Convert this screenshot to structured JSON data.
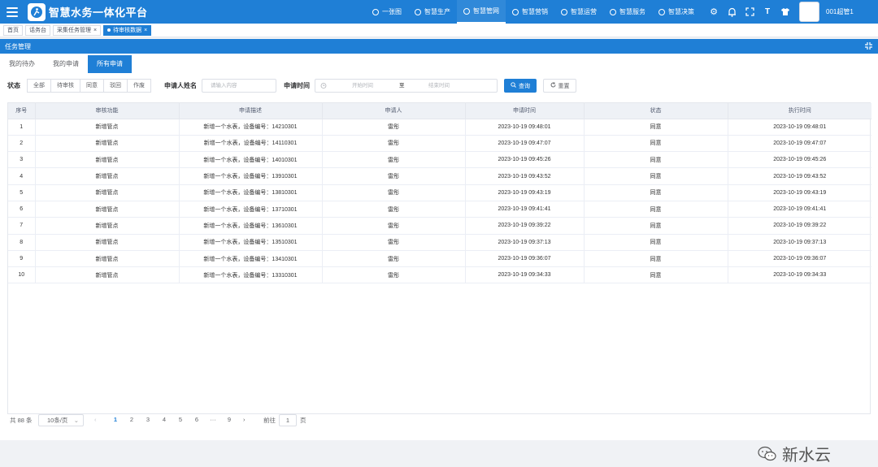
{
  "header": {
    "app_title": "智慧水务一体化平台",
    "nav": [
      {
        "label": "一张图",
        "icon": "globe-icon",
        "active": false
      },
      {
        "label": "智慧生产",
        "icon": "factory-icon",
        "active": false
      },
      {
        "label": "智慧管网",
        "icon": "network-icon",
        "active": true
      },
      {
        "label": "智慧营销",
        "icon": "marketing-icon",
        "active": false
      },
      {
        "label": "智慧运营",
        "icon": "operation-icon",
        "active": false
      },
      {
        "label": "智慧服务",
        "icon": "service-icon",
        "active": false
      },
      {
        "label": "智慧决策",
        "icon": "decision-icon",
        "active": false
      }
    ],
    "user": "001超管1"
  },
  "tabs": [
    {
      "label": "首页",
      "closable": false,
      "active": false
    },
    {
      "label": "话务台",
      "closable": false,
      "active": false
    },
    {
      "label": "采集任务管理",
      "closable": true,
      "active": false
    },
    {
      "label": "待审核数据",
      "closable": true,
      "active": true
    }
  ],
  "panel": {
    "title": "任务管理"
  },
  "subtabs": [
    {
      "label": "我的待办",
      "active": false
    },
    {
      "label": "我的申请",
      "active": false
    },
    {
      "label": "所有申请",
      "active": true
    }
  ],
  "filters": {
    "status_label": "状态",
    "status_options": [
      "全部",
      "待审核",
      "同意",
      "驳回",
      "作废"
    ],
    "applicant_label": "申请人姓名",
    "applicant_placeholder": "请输入内容",
    "time_label": "申请时间",
    "start_placeholder": "开始时间",
    "range_sep": "至",
    "end_placeholder": "结束时间",
    "query_btn": "查询",
    "reset_btn": "重置"
  },
  "table": {
    "columns": [
      "序号",
      "审核功能",
      "申请描述",
      "申请人",
      "申请时间",
      "状态",
      "执行时间"
    ],
    "rows": [
      [
        "1",
        "新增管点",
        "新增一个水表，设备编号：14210301",
        "雷彤",
        "2023-10-19 09:48:01",
        "同意",
        "2023-10-19 09:48:01"
      ],
      [
        "2",
        "新增管点",
        "新增一个水表，设备编号：14110301",
        "雷彤",
        "2023-10-19 09:47:07",
        "同意",
        "2023-10-19 09:47:07"
      ],
      [
        "3",
        "新增管点",
        "新增一个水表，设备编号：14010301",
        "雷彤",
        "2023-10-19 09:45:26",
        "同意",
        "2023-10-19 09:45:26"
      ],
      [
        "4",
        "新增管点",
        "新增一个水表，设备编号：13910301",
        "雷彤",
        "2023-10-19 09:43:52",
        "同意",
        "2023-10-19 09:43:52"
      ],
      [
        "5",
        "新增管点",
        "新增一个水表，设备编号：13810301",
        "雷彤",
        "2023-10-19 09:43:19",
        "同意",
        "2023-10-19 09:43:19"
      ],
      [
        "6",
        "新增管点",
        "新增一个水表，设备编号：13710301",
        "雷彤",
        "2023-10-19 09:41:41",
        "同意",
        "2023-10-19 09:41:41"
      ],
      [
        "7",
        "新增管点",
        "新增一个水表，设备编号：13610301",
        "雷彤",
        "2023-10-19 09:39:22",
        "同意",
        "2023-10-19 09:39:22"
      ],
      [
        "8",
        "新增管点",
        "新增一个水表，设备编号：13510301",
        "雷彤",
        "2023-10-19 09:37:13",
        "同意",
        "2023-10-19 09:37:13"
      ],
      [
        "9",
        "新增管点",
        "新增一个水表，设备编号：13410301",
        "雷彤",
        "2023-10-19 09:36:07",
        "同意",
        "2023-10-19 09:36:07"
      ],
      [
        "10",
        "新增管点",
        "新增一个水表，设备编号：13310301",
        "雷彤",
        "2023-10-19 09:34:33",
        "同意",
        "2023-10-19 09:34:33"
      ]
    ]
  },
  "pagination": {
    "total": "共 88 条",
    "page_size": "10条/页",
    "prev": "‹",
    "pages": [
      "1",
      "2",
      "3",
      "4",
      "5",
      "6",
      "···",
      "9"
    ],
    "current": "1",
    "next": "›",
    "goto_label": "前往",
    "goto_value": "1",
    "goto_suffix": "页"
  },
  "watermark": {
    "text": "新水云"
  },
  "colors": {
    "primary": "#1f7fd6"
  }
}
